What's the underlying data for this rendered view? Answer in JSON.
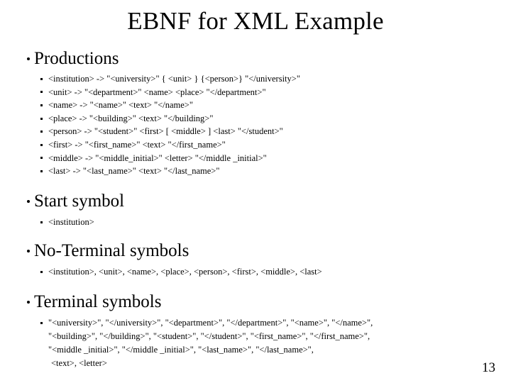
{
  "slide": {
    "title": "EBNF for XML Example",
    "page_number": "13",
    "sections": [
      {
        "heading": "Productions",
        "items": [
          "<institution> -> \"<university>\" { <unit> } {<person>} \"</university>\"",
          "<unit> -> \"<department>\"  <name>  <place> \"</department>\"",
          "<name> -> \"<name>\"  <text> \"</name>\"",
          "<place> -> \"<building>\"  <text> \"</building>\"",
          "<person> -> \"<student>\"  <first> [ <middle> ] <last> \"</student>\"",
          "<first> -> \"<first_name>\"  <text> \"</first_name>\"",
          "<middle> -> \"<middle_initial>\"  <letter> \"</middle _initial>\"",
          "<last> -> \"<last_name>\"  <text> \"</last_name>\""
        ]
      },
      {
        "heading": "Start symbol",
        "items": [
          "<institution>"
        ]
      },
      {
        "heading": "No-Terminal symbols",
        "items": [
          "<institution>, <unit>, <name>, <place>, <person>, <first>, <middle>, <last>"
        ]
      },
      {
        "heading": "Terminal symbols",
        "wrapped_lines": [
          "\"<university>\", \"</university>\", \"<department>\", \"</department>\", \"<name>\", \"</name>\",",
          "\"<building>\", \"</building>\", \"<student>\", \"</student>\", \"<first_name>\", \"</first_name>\",",
          "\"<middle _initial>\", \"</middle _initial>\", \"<last_name>\", \"</last_name>\",",
          "<text>, <letter>"
        ]
      }
    ]
  }
}
